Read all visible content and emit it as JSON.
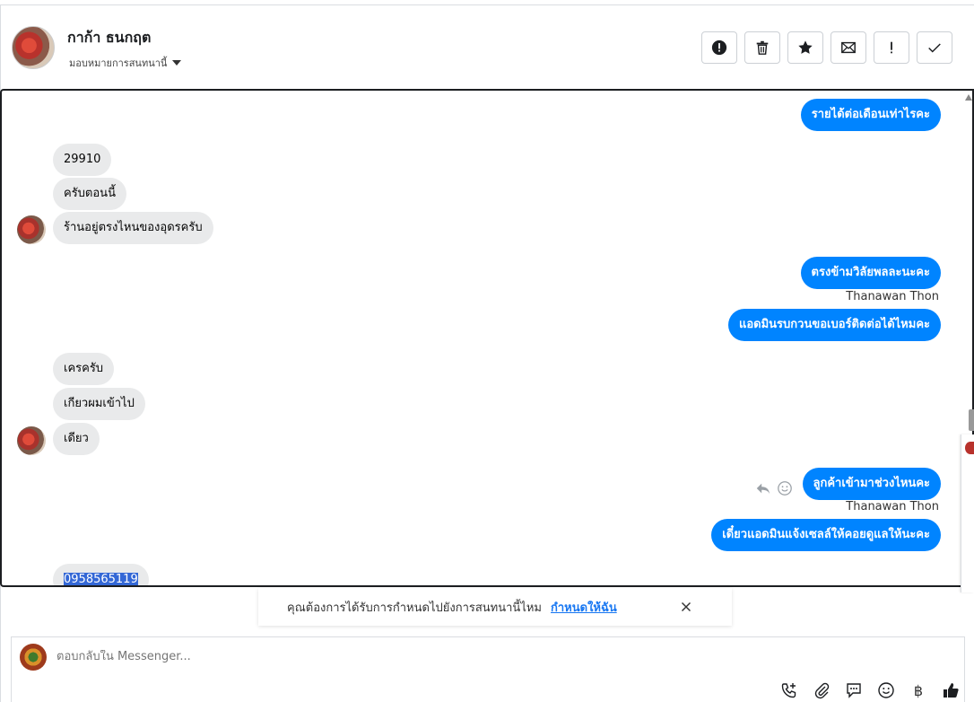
{
  "header": {
    "contact_name": "กาก้า ธนกฤต",
    "assign_label": "มอบหมายการสนทนานี้",
    "actions": [
      {
        "name": "report-button",
        "icon": "alert-circle-icon"
      },
      {
        "name": "delete-button",
        "icon": "trash-icon"
      },
      {
        "name": "star-button",
        "icon": "star-icon"
      },
      {
        "name": "mark-unread-button",
        "icon": "envelope-icon"
      },
      {
        "name": "follow-up-button",
        "icon": "exclamation-icon"
      },
      {
        "name": "done-button",
        "icon": "check-icon"
      }
    ]
  },
  "messages": {
    "m1": "รายได้ต่อเดือนเท่าไรคะ",
    "m2": "29910",
    "m3": "ครับตอนนี้",
    "m4": "ร้านอยู่ตรงไหนของอุดรครับ",
    "m5": "ตรงข้ามวิลัยพลละนะคะ",
    "m6": "แอดมินรบกวนขอเบอร์ติดต่อได้ไหมคะ",
    "m7": "เครครับ",
    "m8": "เกียวผมเข้าไป",
    "m9": "เดียว",
    "m10": "ลูกค้าเข้ามาช่วงไหนคะ",
    "m11": "เดี๋ยวแอดมินแจ้งเซลล์ให้คอยดูแลให้นะคะ",
    "m12": "0958565119",
    "sender_1": "Thanawan Thon",
    "sender_2": "Thanawan Thon"
  },
  "notice": {
    "text": "คุณต้องการได้รับการกำหนดไปยังการสนทนานี้ไหม",
    "link": "กำหนดให้ฉัน"
  },
  "composer": {
    "placeholder": "ตอบกลับใน Messenger...",
    "currency_symbol": "฿"
  },
  "colors": {
    "outgoing_bubble": "#0084ff",
    "incoming_bubble": "#e9eaeb",
    "highlight": "#3367d6"
  }
}
